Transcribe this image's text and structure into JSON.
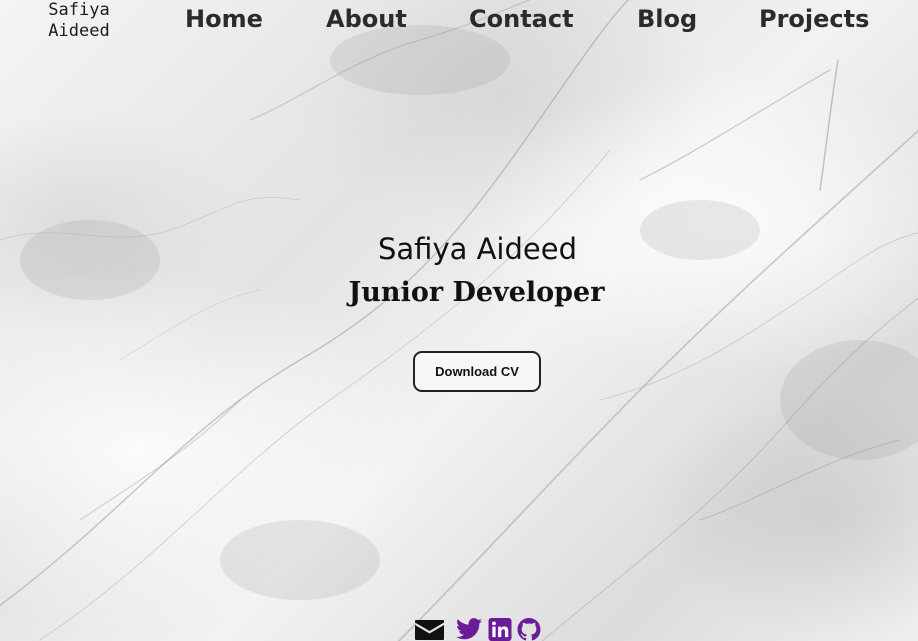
{
  "header": {
    "brand_line1": "Safiya",
    "brand_line2": "Aideed",
    "nav": {
      "home": "Home",
      "about": "About",
      "contact": "Contact",
      "blog": "Blog",
      "projects": "Projects"
    }
  },
  "hero": {
    "name": "Safiya Aideed",
    "role": "Junior Developer",
    "cv_button": "Download CV"
  },
  "social": {
    "icons": [
      "envelope-icon",
      "twitter-icon",
      "linkedin-icon",
      "github-icon"
    ],
    "mail_color": "#111111",
    "brand_color": "#6a1b9a"
  }
}
